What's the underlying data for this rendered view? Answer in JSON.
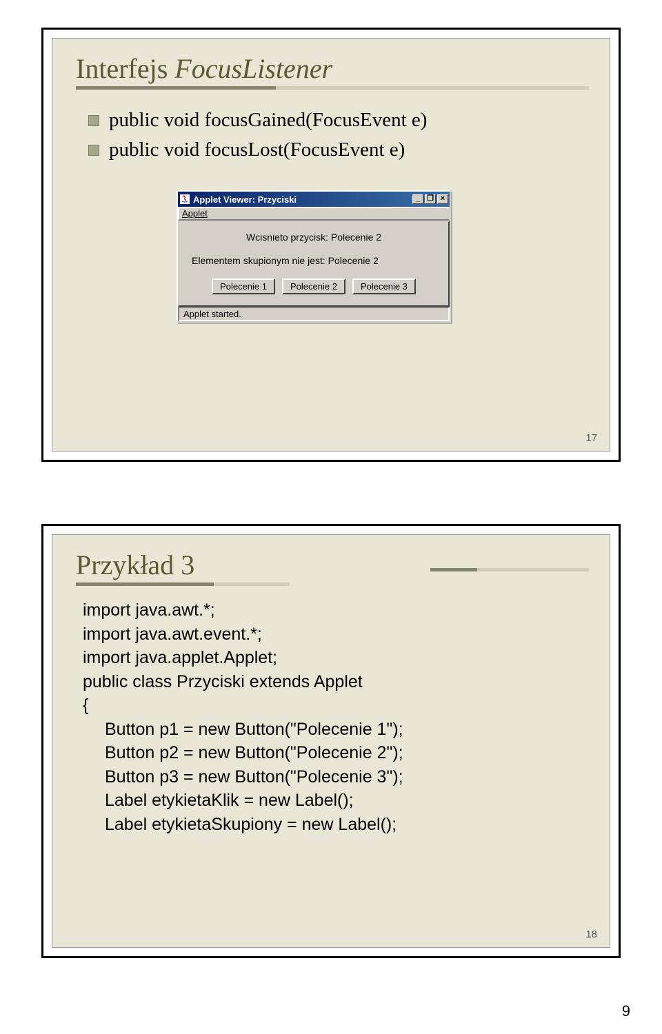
{
  "slide1": {
    "titlePlain": "Interfejs ",
    "titleItalic": "FocusListener",
    "bullets": [
      "public void focusGained(FocusEvent e)",
      "public void focusLost(FocusEvent e)"
    ],
    "slideNum": "17",
    "applet": {
      "windowTitle": "Applet Viewer: Przyciski",
      "menu": "Applet",
      "line1": "Wcisnieto przycisk: Polecenie 2",
      "line2": "Elementem skupionym nie jest: Polecenie 2",
      "buttons": [
        "Polecenie 1",
        "Polecenie 2",
        "Polecenie 3"
      ],
      "status": "Applet started.",
      "icons": {
        "minimize": "_",
        "maximize": "❐",
        "close": "×"
      }
    }
  },
  "slide2": {
    "title": "Przykład 3",
    "slideNum": "18",
    "code": [
      "import java.awt.*;",
      "import java.awt.event.*;",
      "import java.applet.Applet;",
      "public class Przyciski extends Applet",
      "{",
      "  Button p1 = new Button(\"Polecenie 1\");",
      "  Button p2 = new Button(\"Polecenie 2\");",
      "  Button p3 = new Button(\"Polecenie 3\");",
      "  Label etykietaKlik = new Label();",
      "  Label etykietaSkupiony = new Label();"
    ]
  },
  "pageNum": "9"
}
